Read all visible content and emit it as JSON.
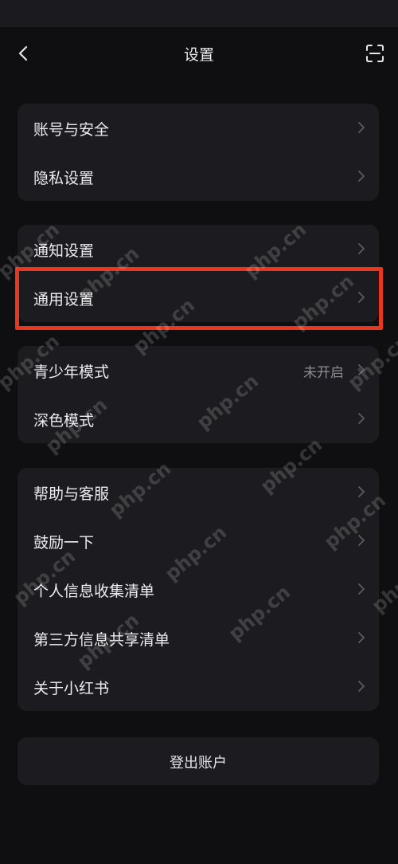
{
  "header": {
    "title": "设置",
    "back_icon": "chevron-left-icon",
    "scan_icon": "scan-icon"
  },
  "groups": [
    {
      "items": [
        {
          "label": "账号与安全"
        },
        {
          "label": "隐私设置"
        }
      ]
    },
    {
      "items": [
        {
          "label": "通知设置"
        },
        {
          "label": "通用设置"
        }
      ]
    },
    {
      "items": [
        {
          "label": "青少年模式",
          "value": "未开启"
        },
        {
          "label": "深色模式"
        }
      ]
    },
    {
      "items": [
        {
          "label": "帮助与客服"
        },
        {
          "label": "鼓励一下"
        },
        {
          "label": "个人信息收集清单"
        },
        {
          "label": "第三方信息共享清单"
        },
        {
          "label": "关于小红书"
        }
      ]
    }
  ],
  "logout": {
    "label": "登出账户"
  },
  "watermark": {
    "text": "php.cn"
  },
  "colors": {
    "background": "#0f0f12",
    "card": "#1c1c20",
    "highlight": "#e8361f",
    "text": "#ededf0",
    "secondary": "#8c8c93"
  }
}
